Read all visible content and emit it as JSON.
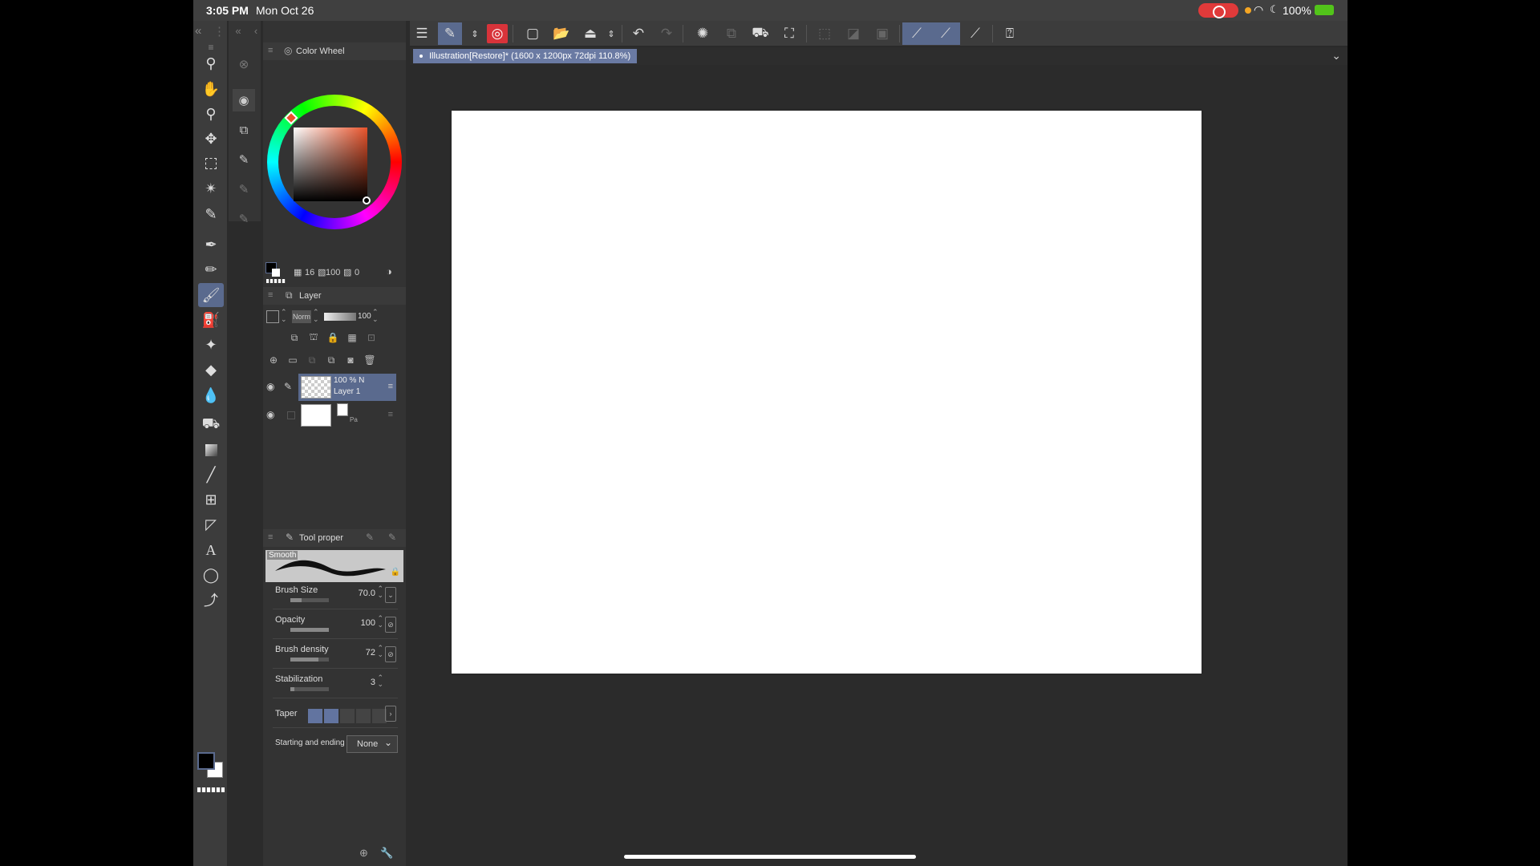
{
  "status_bar": {
    "time": "3:05 PM",
    "date": "Mon Oct 26",
    "battery": "100%"
  },
  "tools": [
    {
      "name": "zoom",
      "icon": "magnifier-icon"
    },
    {
      "name": "move",
      "icon": "hand-icon"
    },
    {
      "name": "operation",
      "icon": "object-select-icon"
    },
    {
      "name": "move-layer",
      "icon": "move-arrows-icon"
    },
    {
      "name": "selection",
      "icon": "marquee-icon"
    },
    {
      "name": "auto-select",
      "icon": "magic-wand-icon"
    },
    {
      "name": "eyedropper",
      "icon": "eyedropper-icon"
    },
    {
      "name": "pen",
      "icon": "pen-icon"
    },
    {
      "name": "pencil",
      "icon": "pencil-icon"
    },
    {
      "name": "brush",
      "icon": "brush-icon"
    },
    {
      "name": "airbrush",
      "icon": "airbrush-icon"
    },
    {
      "name": "decoration",
      "icon": "sparkle-icon"
    },
    {
      "name": "eraser",
      "icon": "eraser-icon"
    },
    {
      "name": "blend",
      "icon": "blend-icon"
    },
    {
      "name": "fill",
      "icon": "bucket-icon"
    },
    {
      "name": "gradient",
      "icon": "gradient-icon"
    },
    {
      "name": "figure",
      "icon": "line-icon"
    },
    {
      "name": "frame",
      "icon": "frame-icon"
    },
    {
      "name": "ruler",
      "icon": "ruler-icon"
    },
    {
      "name": "text",
      "icon": "text-icon"
    },
    {
      "name": "balloon",
      "icon": "balloon-icon"
    },
    {
      "name": "correct-line",
      "icon": "correct-line-icon"
    }
  ],
  "color_wheel": {
    "title": "Color Wheel",
    "footer_values": [
      "16",
      "100",
      "0"
    ]
  },
  "layer_panel": {
    "title": "Layer",
    "blend_mode": "Norm",
    "opacity": "100",
    "layers": [
      {
        "pct": "100 % N",
        "name": "Layer 1",
        "selected": true
      },
      {
        "pct": "",
        "name": "Pa",
        "selected": false
      }
    ]
  },
  "tool_property": {
    "title": "Tool proper",
    "brush_name": "Smooth",
    "props": [
      {
        "label": "Brush Size",
        "value": "70.0",
        "fill": 0.3
      },
      {
        "label": "Opacity",
        "value": "100",
        "fill": 1.0
      },
      {
        "label": "Brush density",
        "value": "72",
        "fill": 0.72
      },
      {
        "label": "Stabilization",
        "value": "3",
        "fill": 0.1
      }
    ],
    "taper_label": "Taper",
    "start_end_label": "Starting and ending",
    "start_end_value": "None"
  },
  "document": {
    "tab_title": "Illustration[Restore]* (1600 x 1200px 72dpi 110.8%)"
  },
  "colors": {
    "main": "#000000",
    "sub": "#ffffff",
    "accent": "#5a6a8e",
    "selected_hue": "#e8532b"
  }
}
